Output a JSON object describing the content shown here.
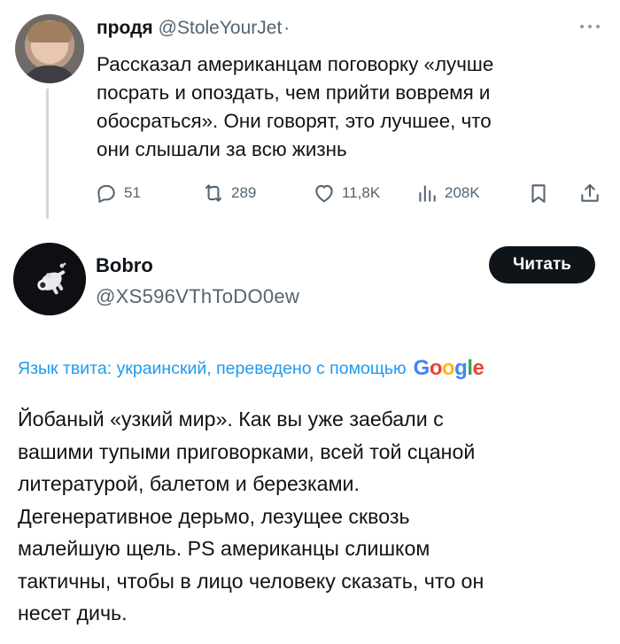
{
  "tweet": {
    "author_name": "продя",
    "author_handle": "@StoleYourJet",
    "separator": "·",
    "text_lines": [
      "Рассказал американцам поговорку «лучше",
      "посрать и опоздать, чем прийти вовремя и",
      "обосраться». Они говорят, это лучшее, что",
      "они слышали за всю жизнь"
    ],
    "actions": {
      "replies": "51",
      "reposts": "289",
      "likes": "11,8K",
      "views": "208K"
    },
    "icons": [
      "reply-icon",
      "repost-icon",
      "like-icon",
      "views-icon",
      "bookmark-icon",
      "share-icon",
      "more-icon"
    ]
  },
  "quoted": {
    "author_name": "Bobro",
    "author_handle": "@XS596VThToDO0ew",
    "read_button_label": "Читать",
    "translation_label": "Язык твита: украинский, переведено с помощью",
    "translation_provider": "Google",
    "text_lines": [
      "Йобаный «узкий мир». Как вы уже заебали с",
      "вашими тупыми приговорками, всей той сцаной",
      "литературой, балетом и березками.",
      "Дегенеративное дерьмо, лезущее сквозь",
      "малейшую щель. PS американцы слишком",
      "тактичны, чтобы в лицо человеку сказать, что он",
      "несет дичь."
    ]
  },
  "colors": {
    "text": "#0f1419",
    "secondary": "#536471",
    "link": "#1d9bf0",
    "button_bg": "#0f1419",
    "thread_line": "#cfd9de"
  }
}
